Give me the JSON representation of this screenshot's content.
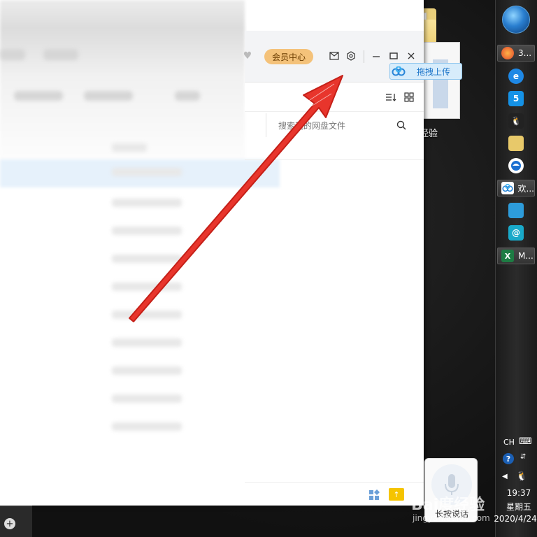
{
  "window": {
    "vip_label": "会员中心",
    "search_placeholder": "搜索我的网盘文件",
    "icons": [
      "mail-icon",
      "gear-icon",
      "minimize-icon",
      "maximize-icon",
      "close-icon",
      "sort-icon",
      "grid-view-icon",
      "search-icon",
      "apps-icon",
      "upload-folder-icon"
    ]
  },
  "drag_upload": {
    "label": "拖拽上传"
  },
  "voice_widget": {
    "label": "长按说话"
  },
  "desktop": {
    "file_label": "经验"
  },
  "taskbar": {
    "items": [
      {
        "label": "3...",
        "icon": "firefox-icon"
      },
      {
        "label": "欢...",
        "icon": "baidu-netdisk-icon"
      },
      {
        "label": "M...",
        "icon": "excel-icon"
      }
    ],
    "language": "CH",
    "clock": {
      "time": "19:37",
      "day": "星期五",
      "date": "2020/4/24"
    }
  },
  "watermark": {
    "text": "Bai度经验",
    "sub": "jingyan.baidu.com"
  },
  "colors": {
    "vip": "#f4c27a",
    "drag_bg": "#d7ecfb",
    "arrow": "#e8352c"
  }
}
